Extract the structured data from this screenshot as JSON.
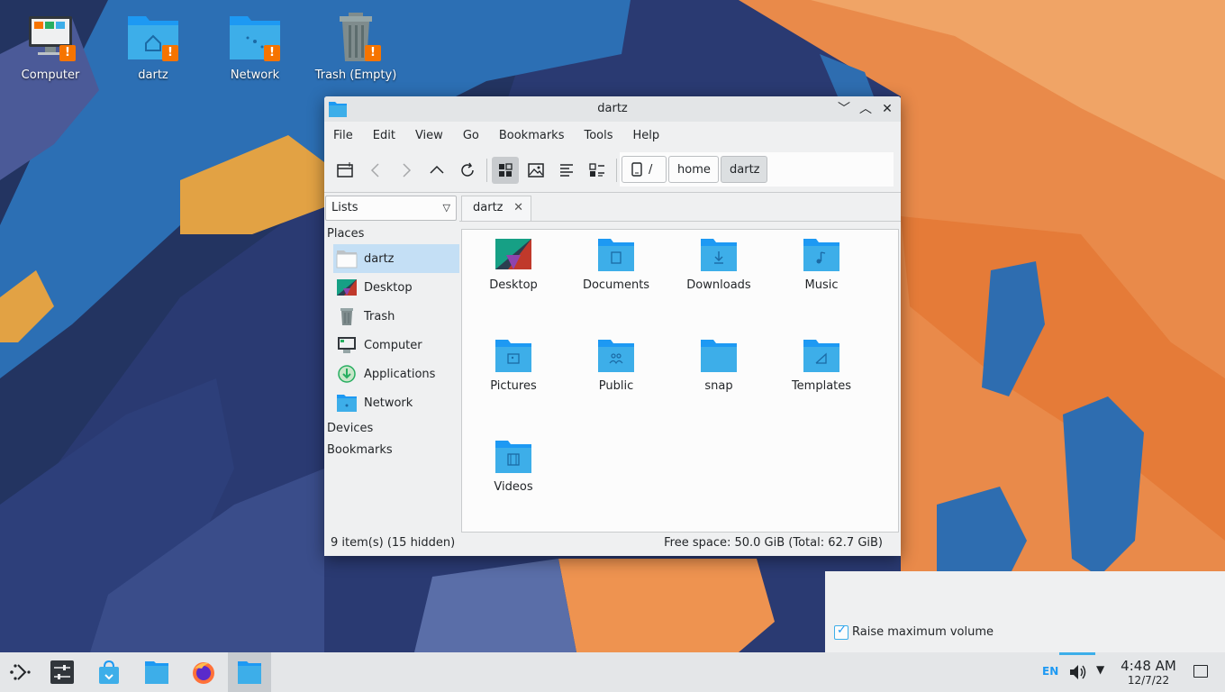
{
  "desktop": {
    "icons": [
      {
        "label": "Computer",
        "icon": "computer-icon"
      },
      {
        "label": "dartz",
        "icon": "home-folder-icon"
      },
      {
        "label": "Network",
        "icon": "network-folder-icon"
      },
      {
        "label": "Trash (Empty)",
        "icon": "trash-icon"
      }
    ],
    "warning_badge": "!"
  },
  "window": {
    "title": "dartz",
    "controls": {
      "minimize": "﹀",
      "maximize": "︿",
      "close": "✕"
    },
    "menu": [
      "File",
      "Edit",
      "View",
      "Go",
      "Bookmarks",
      "Tools",
      "Help"
    ],
    "breadcrumb": {
      "root": "/",
      "parts": [
        "home",
        "dartz"
      ]
    },
    "panel_combo": "Lists",
    "places": {
      "header": "Places",
      "items": [
        {
          "label": "dartz",
          "icon": "home-folder-icon",
          "selected": true
        },
        {
          "label": "Desktop",
          "icon": "desktop-icon"
        },
        {
          "label": "Trash",
          "icon": "trash-icon"
        },
        {
          "label": "Computer",
          "icon": "computer-icon"
        },
        {
          "label": "Applications",
          "icon": "applications-icon"
        },
        {
          "label": "Network",
          "icon": "network-icon"
        }
      ],
      "devices": "Devices",
      "bookmarks": "Bookmarks"
    },
    "tab": {
      "label": "dartz",
      "close": "✕"
    },
    "files": [
      {
        "name": "Desktop",
        "emblem": "desktop"
      },
      {
        "name": "Documents",
        "emblem": "document"
      },
      {
        "name": "Downloads",
        "emblem": "download"
      },
      {
        "name": "Music",
        "emblem": "music"
      },
      {
        "name": "Pictures",
        "emblem": "picture"
      },
      {
        "name": "Public",
        "emblem": "people"
      },
      {
        "name": "snap",
        "emblem": "none"
      },
      {
        "name": "Templates",
        "emblem": "template"
      },
      {
        "name": "Videos",
        "emblem": "video"
      }
    ],
    "status": {
      "left": "9 item(s) (15 hidden)",
      "right": "Free space: 50.0 GiB (Total: 62.7 GiB)"
    }
  },
  "osd": {
    "checkbox_label": "Raise maximum volume",
    "checked": true
  },
  "taskbar": {
    "tray": {
      "language": "EN"
    },
    "clock": {
      "time": "4:48 AM",
      "date": "12/7/22"
    }
  },
  "colors": {
    "folder_blue": "#3daee9",
    "folder_dark": "#1d99f3",
    "accent": "#3daee9",
    "warning": "#f67400"
  }
}
